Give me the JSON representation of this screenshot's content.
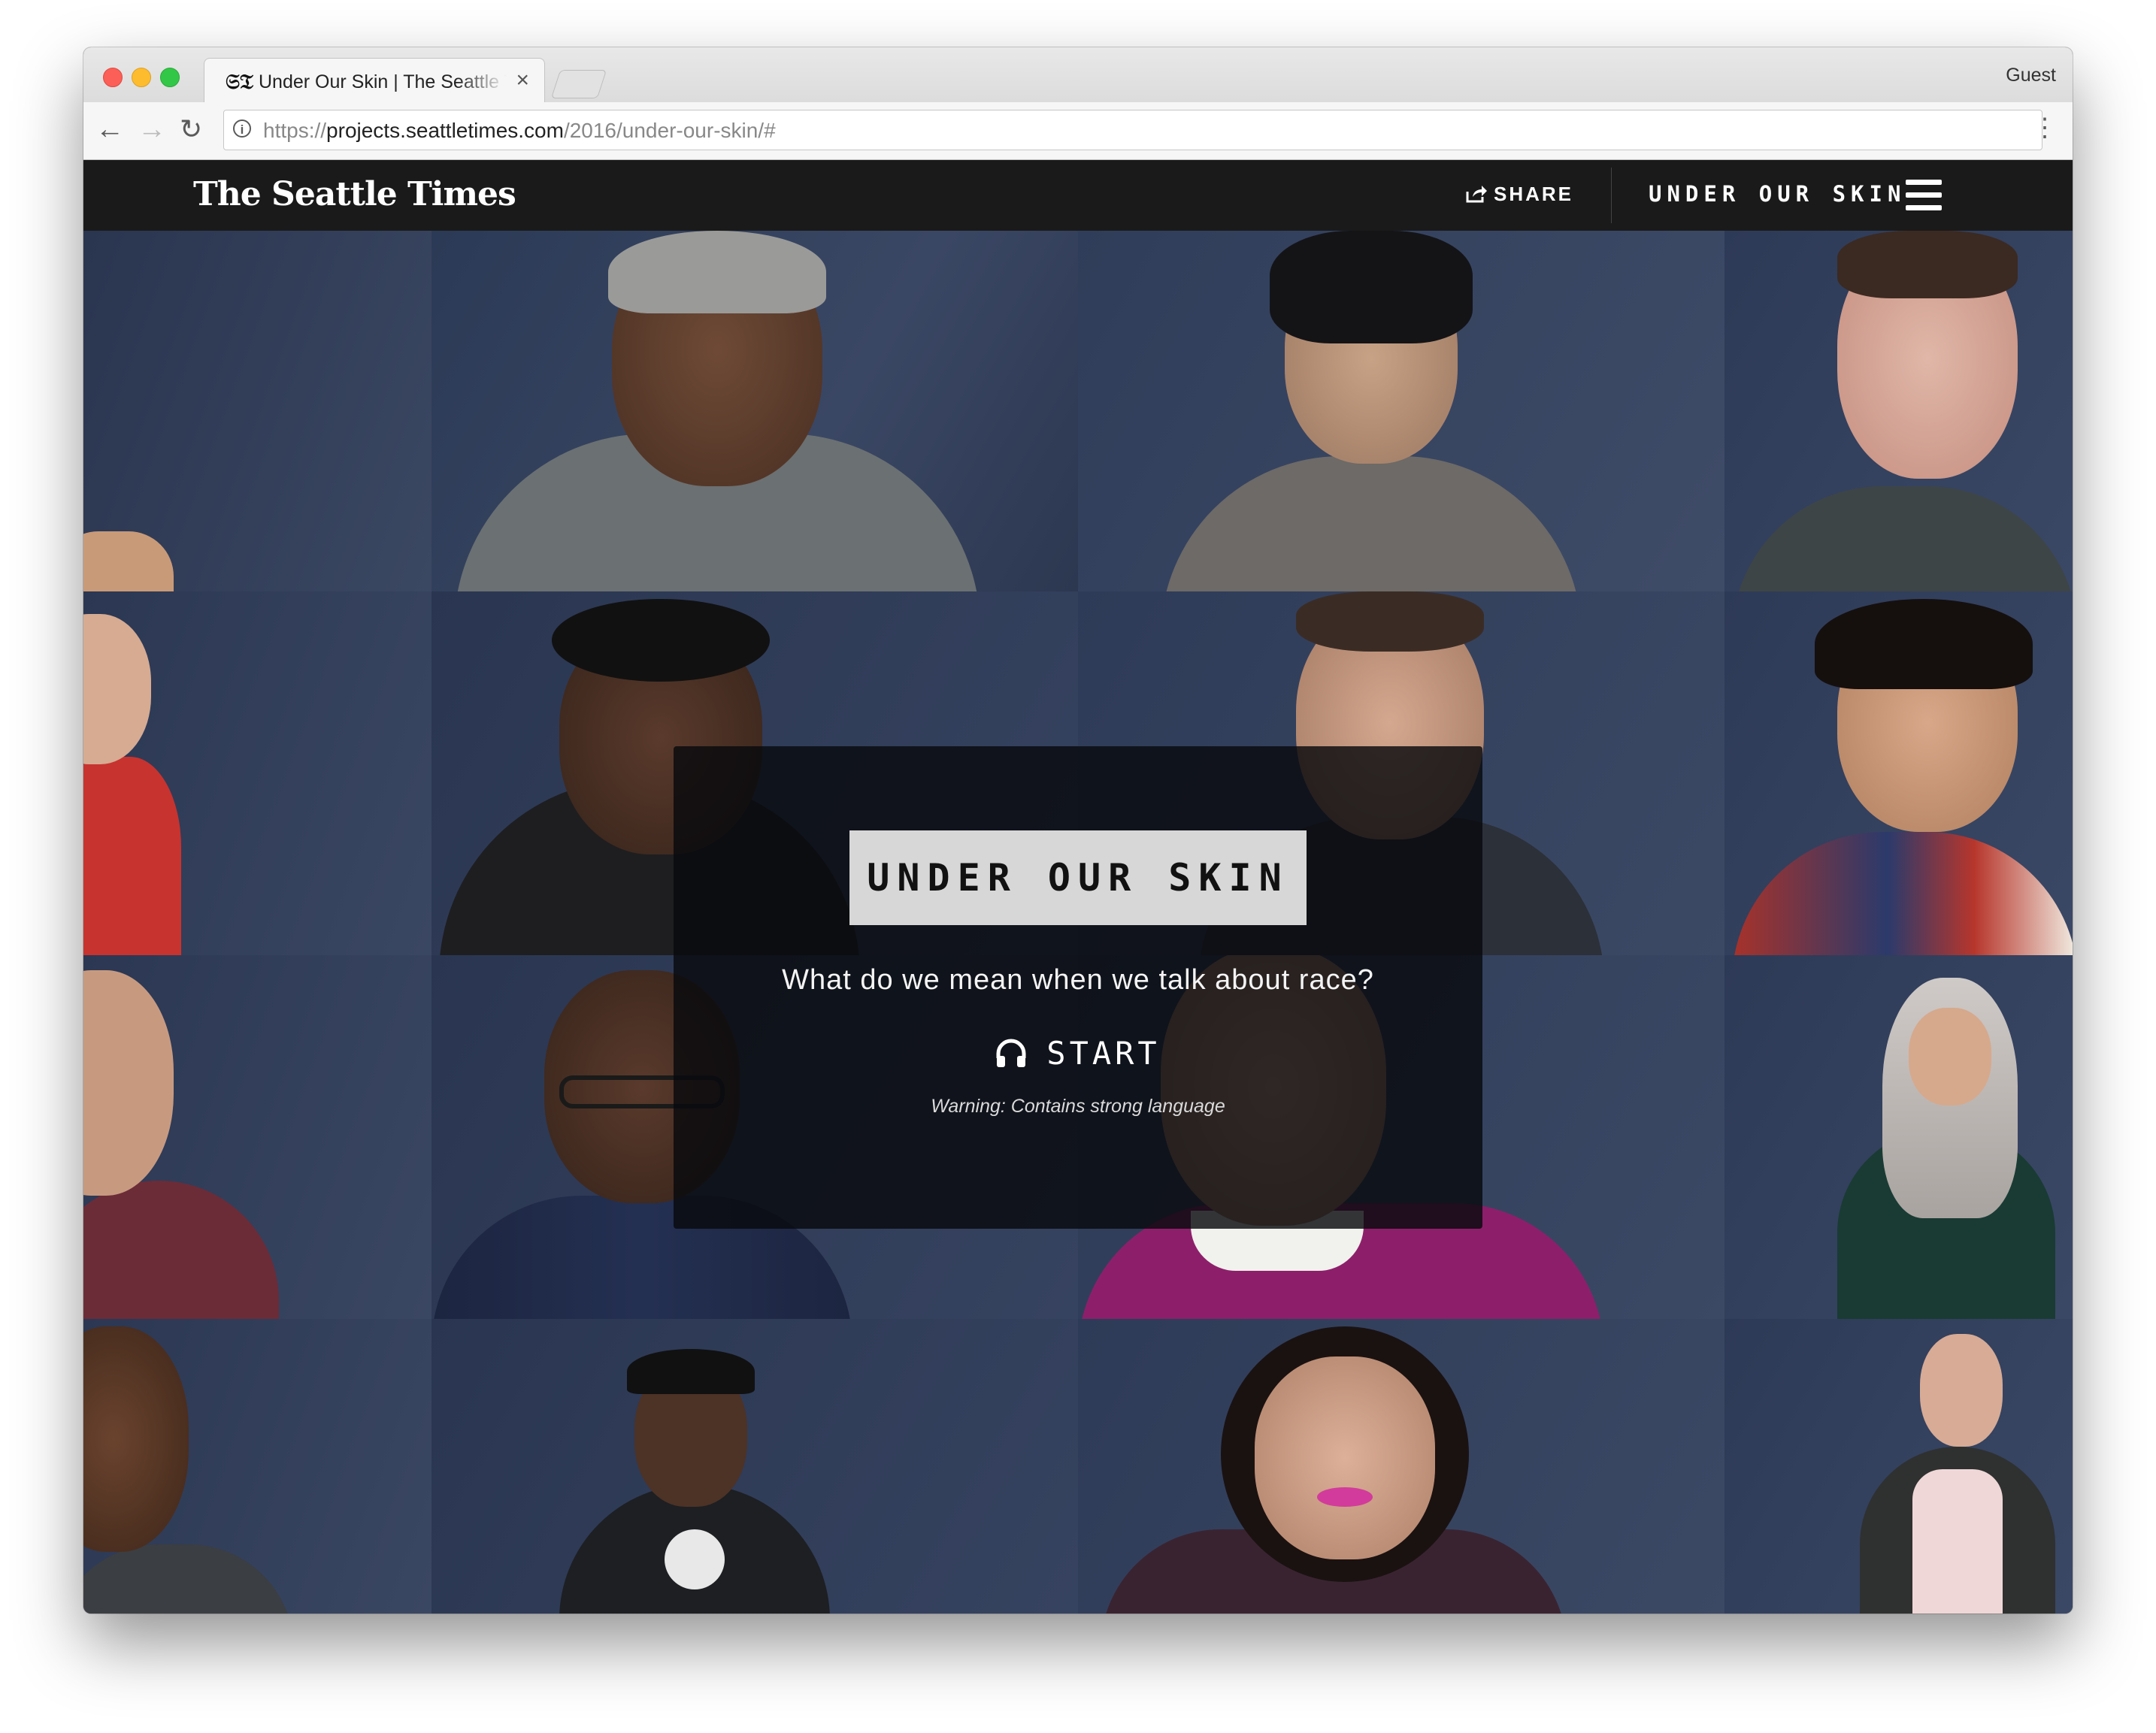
{
  "browser": {
    "tab_title": "Under Our Skin | The Seattle Times",
    "tab_favicon": "𝔖𝔗",
    "tab_close_glyph": "×",
    "profile_label": "Guest",
    "url_scheme": "https://",
    "url_host": "projects.seattletimes.com",
    "url_path": "/2016/under-our-skin/#",
    "icons": {
      "back": "arrow-left-icon",
      "forward": "arrow-right-icon",
      "reload": "reload-icon",
      "info": "info-icon",
      "menu": "vertical-dots-icon"
    }
  },
  "site_header": {
    "logo": "The Seattle Times",
    "share_label": "SHARE",
    "series_title": "UNDER OUR SKIN",
    "icons": {
      "share": "share-icon",
      "menu": "hamburger-icon"
    }
  },
  "hero": {
    "title": "UNDER OUR SKIN",
    "subtitle": "What do we mean when we talk about race?",
    "start_label": "START",
    "start_icon": "headphones-icon",
    "warning": "Warning: Contains strong language"
  },
  "colors": {
    "header_bg": "#1a1a1a",
    "title_box_bg": "#d7d7d7",
    "backdrop_blue": "#2e3a55"
  }
}
